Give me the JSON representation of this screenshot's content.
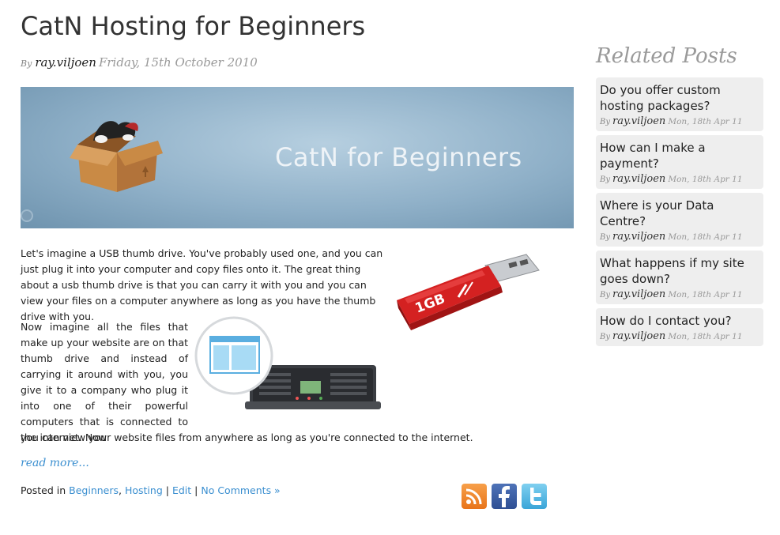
{
  "post": {
    "title": "CatN Hosting for Beginners",
    "by": "By",
    "author": "ray.viljoen",
    "date": "Friday, 15th October 2010",
    "banner_text": "CatN for Beginners",
    "paragraph1": "Let's imagine a USB thumb drive. You've probably used one, and you can just plug it into your computer and copy files onto it. The great thing about a usb thumb drive is that you can carry it with you and you can view your files on a computer anywhere as long as you have the thumb drive with you.",
    "paragraph2": "Now imagine all the files that make up your website are on that thumb drive and instead of carrying it around with you, you give it to a company who plug it into one of their powerful computers that is connected to the internet. Now",
    "paragraph2_end": "you can view your website files from anywhere as long as you're connected to the internet.",
    "usb_label": "1GB",
    "read_more": "read more...",
    "posted_in": "Posted in",
    "categories": [
      "Beginners",
      "Hosting"
    ],
    "edit": "Edit",
    "comments": "No Comments »"
  },
  "sidebar": {
    "title": "Related Posts",
    "items": [
      {
        "question": "Do you offer custom hosting packages?",
        "by": "By",
        "author": "ray.viljoen",
        "date": "Mon, 18th Apr 11"
      },
      {
        "question": "How can I make a payment?",
        "by": "By",
        "author": "ray.viljoen",
        "date": "Mon, 18th Apr 11"
      },
      {
        "question": "Where is your Data Centre?",
        "by": "By",
        "author": "ray.viljoen",
        "date": "Mon, 18th Apr 11"
      },
      {
        "question": "What happens if my site goes down?",
        "by": "By",
        "author": "ray.viljoen",
        "date": "Mon, 18th Apr 11"
      },
      {
        "question": "How do I contact you?",
        "by": "By",
        "author": "ray.viljoen",
        "date": "Mon, 18th Apr 11"
      }
    ]
  },
  "social": [
    {
      "icon": "rss-icon",
      "color": "#e8741a"
    },
    {
      "icon": "facebook-icon",
      "color": "#2f4f93"
    },
    {
      "icon": "twitter-icon",
      "color": "#3aa5d8"
    }
  ],
  "colors": {
    "link": "#3b8fd0",
    "related_title": "#9a9a9a",
    "related_bg": "#eeeeee"
  }
}
